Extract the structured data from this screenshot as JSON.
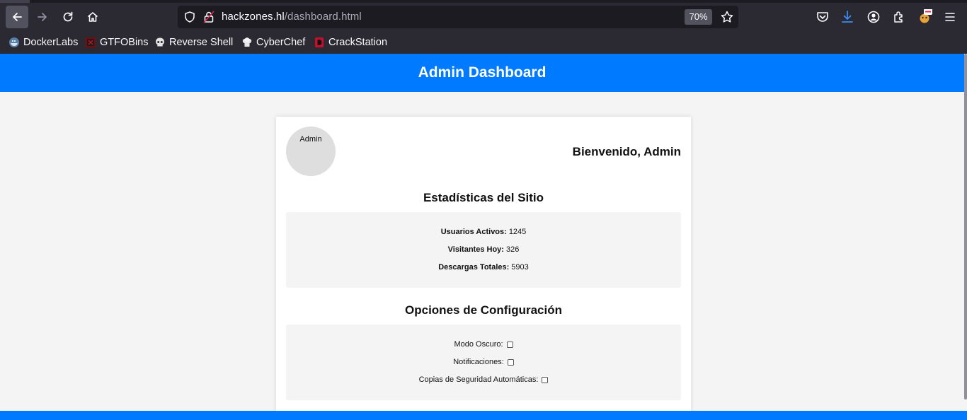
{
  "browser": {
    "url_host": "hackzones.hl",
    "url_path": "/dashboard.html",
    "zoom": "70%",
    "bookmarks": [
      {
        "label": "DockerLabs",
        "icon": "dockerlabs-icon"
      },
      {
        "label": "GTFOBins",
        "icon": "gtfobins-icon"
      },
      {
        "label": "Reverse Shell",
        "icon": "skull-icon"
      },
      {
        "label": "CyberChef",
        "icon": "chef-hat-icon"
      },
      {
        "label": "CrackStation",
        "icon": "crackstation-icon"
      }
    ]
  },
  "page": {
    "header_title": "Admin Dashboard",
    "header_color": "#007bff",
    "avatar_text": "Admin",
    "welcome": "Bienvenido, Admin",
    "stats_title": "Estadísticas del Sitio",
    "stats": [
      {
        "label": "Usuarios Activos:",
        "value": "1245"
      },
      {
        "label": "Visitantes Hoy:",
        "value": "326"
      },
      {
        "label": "Descargas Totales:",
        "value": "5903"
      }
    ],
    "options_title": "Opciones de Configuración",
    "options": [
      {
        "label": "Modo Oscuro:",
        "checked": false
      },
      {
        "label": "Notificaciones:",
        "checked": false
      },
      {
        "label": "Copias de Seguridad Automáticas:",
        "checked": false
      }
    ]
  }
}
